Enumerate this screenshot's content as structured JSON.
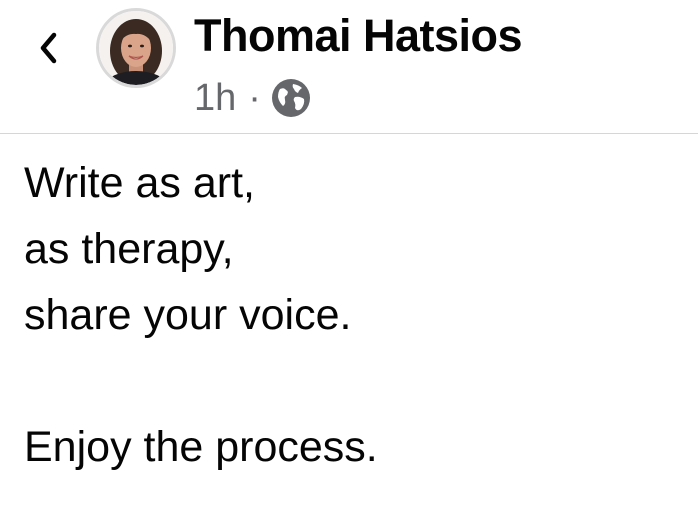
{
  "header": {
    "back_icon": "chevron-left-icon",
    "author_name": "Thomai Hatsios",
    "avatar_icon": "profile-photo",
    "timestamp": "1h",
    "separator": "·",
    "privacy_icon": "globe-icon"
  },
  "post": {
    "lines": [
      "Write as art,",
      "as therapy,",
      "share your voice.",
      "",
      "Enjoy the process."
    ]
  },
  "colors": {
    "text": "#050505",
    "secondary_text": "#65676b",
    "divider": "#d6d6d6"
  }
}
